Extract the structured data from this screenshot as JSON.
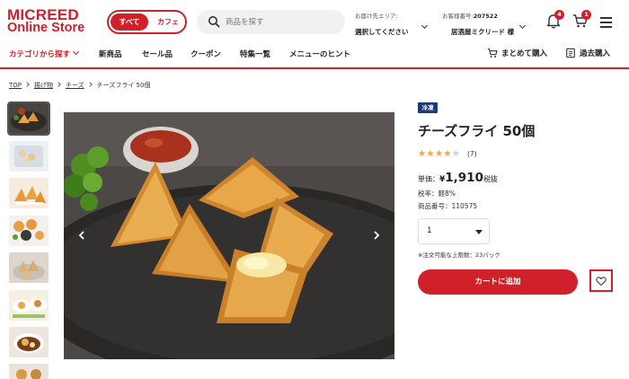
{
  "header": {
    "logo_line1": "MICREED",
    "logo_line2": "Online Store",
    "mode_all": "すべて",
    "mode_cafe": "カフェ",
    "search_placeholder": "商品を探す",
    "delivery_label": "お届け先エリア:",
    "delivery_value": "選択してください",
    "customer_label": "お客様番号:",
    "customer_number": "207522",
    "customer_name": "居酒屋ミクリード 様",
    "notification_count": "4",
    "cart_count": "1"
  },
  "nav": {
    "category": "カテゴリから探す",
    "items": [
      "新商品",
      "セール品",
      "クーポン",
      "特集一覧",
      "メニューのヒント"
    ],
    "bulk_buy": "まとめて購入",
    "past_buy": "過去購入"
  },
  "breadcrumb": {
    "items": [
      "TOP",
      "揚げ物",
      "チーズ"
    ],
    "current": "チーズフライ 50個"
  },
  "product": {
    "badge": "冷凍",
    "title": "チーズフライ 50個",
    "rating": 4,
    "rating_max": 5,
    "review_count": "(7)",
    "price_label": "単価：",
    "price_currency": "¥",
    "price_value": "1,910",
    "price_tax": "税抜",
    "tax_rate": "税率：軽8%",
    "product_number": "商品番号：110575",
    "quantity": "1",
    "order_limit": "※注文可能な上限数：23パック",
    "add_to_cart": "カートに追加"
  },
  "colors": {
    "brand_red": "#d0202a",
    "frozen_badge": "#1a3a78",
    "star": "#f2a33a"
  }
}
